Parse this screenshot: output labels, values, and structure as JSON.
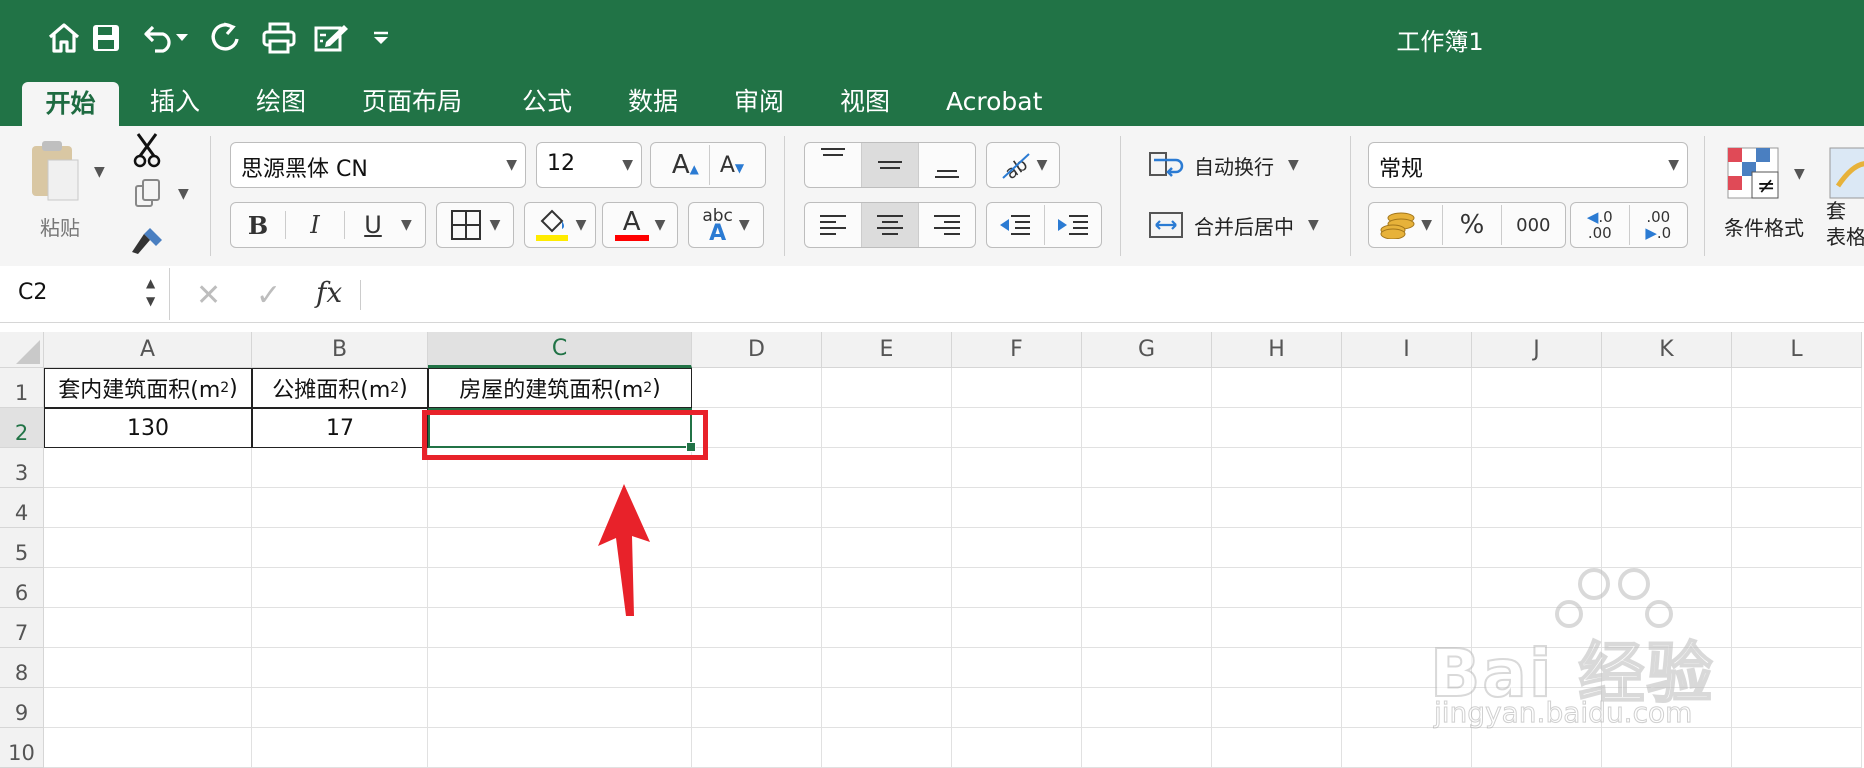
{
  "window": {
    "title": "工作簿1"
  },
  "tabs": [
    {
      "label": "开始",
      "active": true
    },
    {
      "label": "插入"
    },
    {
      "label": "绘图"
    },
    {
      "label": "页面布局"
    },
    {
      "label": "公式"
    },
    {
      "label": "数据"
    },
    {
      "label": "审阅"
    },
    {
      "label": "视图"
    },
    {
      "label": "Acrobat"
    }
  ],
  "ribbon": {
    "paste_label": "粘贴",
    "font_name": "思源黑体 CN",
    "font_size": "12",
    "bold": "B",
    "italic": "I",
    "underline": "U",
    "font_color_letter": "A",
    "abc_label": "abc",
    "wrap_text": "自动换行",
    "merge_center": "合并后居中",
    "number_format": "常规",
    "percent": "%",
    "thousands": "000",
    "cond_format": "条件格式",
    "table_format_partial": "套\n表格",
    "inc_decimal_top": ".0",
    "inc_decimal_bottom": ".00",
    "dec_decimal_top": ".00",
    "dec_decimal_bottom": ".0",
    "fill_color": "#ffeb00",
    "font_color": "#ff0000"
  },
  "formula_bar": {
    "name_box": "C2",
    "fx": "fx",
    "value": ""
  },
  "columns": [
    "A",
    "B",
    "C",
    "D",
    "E",
    "F",
    "G",
    "H",
    "I",
    "J",
    "K",
    "L"
  ],
  "rows": [
    "1",
    "2",
    "3",
    "4",
    "5",
    "6",
    "7",
    "8",
    "9",
    "10"
  ],
  "cells": {
    "A1": {
      "text": "套内建筑面积(m",
      "sup": "2",
      "close": ")"
    },
    "B1": {
      "text": "公摊面积(m",
      "sup": "2",
      "close": ")"
    },
    "C1": {
      "text": "房屋的建筑面积(m",
      "sup": "2",
      "close": ")"
    },
    "A2": "130",
    "B2": "17",
    "C2": ""
  },
  "selected_cell": "C2",
  "watermark": {
    "brand": "Bai 经验",
    "url": "jingyan.baidu.com"
  },
  "colors": {
    "excel_green": "#217346",
    "highlight_red": "#e8222a"
  }
}
